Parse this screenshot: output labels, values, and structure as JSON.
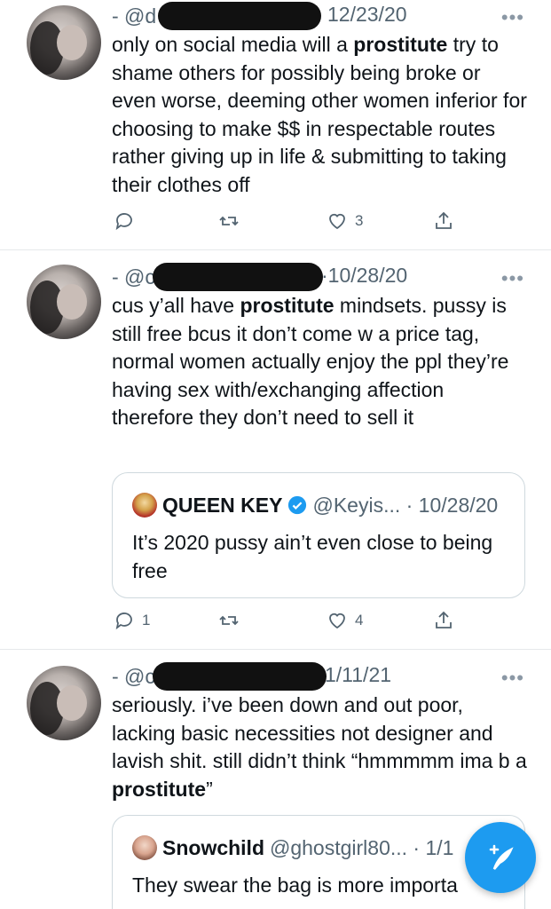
{
  "tweets": [
    {
      "dash_handle": "- @d",
      "date": "12/23/20",
      "text_parts": [
        "only on social media will a ",
        "prostitute",
        " try to shame others for possibly being broke or even worse, deeming other women inferior for choosing to make $$ in respectable routes rather giving up in life & submitting to taking their clothes off"
      ],
      "replies": "",
      "likes": "3"
    },
    {
      "dash_handle": "- @c",
      "date": "10/28/20",
      "text_parts": [
        "cus y’all have ",
        "prostitute",
        " mindsets. pussy is still free bcus it don’t come w a price tag, normal women actually enjoy the ppl they’re having sex with/exchanging affection therefore they don’t need to sell it"
      ],
      "quote": {
        "name": "QUEEN KEY",
        "handle": "@Keyis... · 10/28/20",
        "text": "It’s 2020 pussy ain’t even close to being free"
      },
      "replies": "1",
      "likes": "4"
    },
    {
      "dash_handle": "- @c",
      "date": "1/11/21",
      "text_parts": [
        "seriously. i’ve been down and out poor, lacking basic necessities not designer and lavish shit. still didn’t think “hmmmmm ima b a ",
        "prostitute",
        "”"
      ],
      "quote": {
        "name": "Snowchild",
        "handle": "@ghostgirl80... · 1/1",
        "text": "They swear the bag is more importa"
      }
    }
  ],
  "colors": {
    "accent": "#1d9bf0",
    "muted": "#536471"
  },
  "icons": [
    "reply-icon",
    "retweet-icon",
    "like-icon",
    "share-icon",
    "compose-icon",
    "verified-icon",
    "more-icon"
  ]
}
